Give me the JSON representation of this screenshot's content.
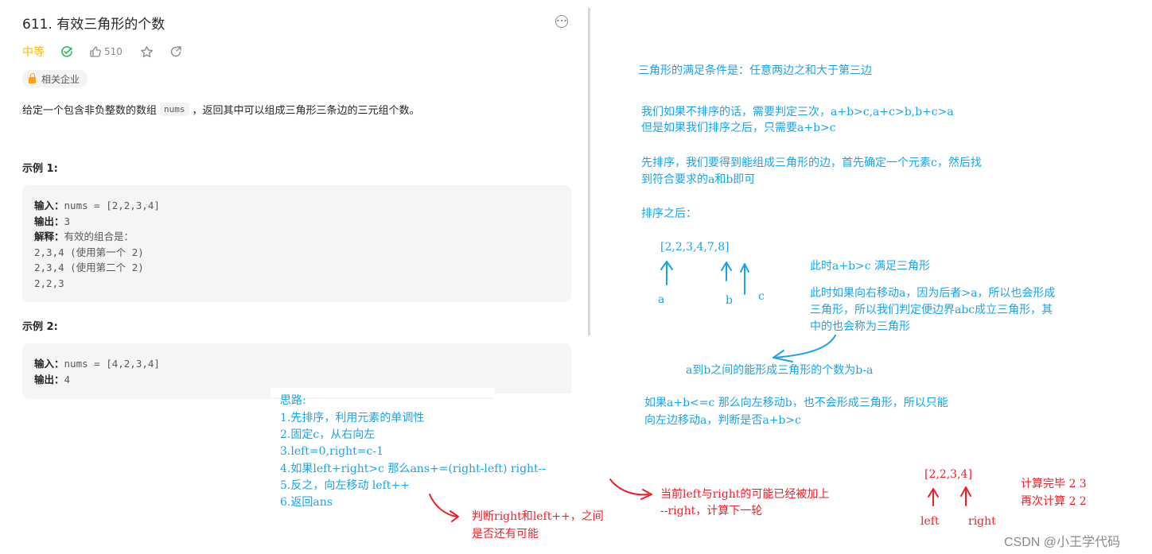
{
  "problem": {
    "title": "611. 有效三角形的个数",
    "difficulty": "中等",
    "likes": "510",
    "tag_label": "相关企业",
    "description_before": "给定一个包含非负整数的数组",
    "description_code": "nums",
    "description_after": "，返回其中可以组成三角形三条边的三元组个数。",
    "icons": {
      "solved": "check-circle-icon",
      "like": "thumbs-up-icon",
      "favorite": "star-icon",
      "share": "share-icon",
      "more": "more-options-icon",
      "tag": "lock-icon"
    },
    "colors": {
      "difficulty": "#ffb800",
      "solved": "#2db55d",
      "lock": "#ffa116"
    },
    "examples": [
      {
        "heading": "示例 1:",
        "input_label": "输入：",
        "input_value": "nums = [2,2,3,4]",
        "output_label": "输出：",
        "output_value": "3",
        "explain_label": "解释：",
        "explain_value": "有效的组合是：",
        "explain_lines": [
          "2,3,4 (使用第一个 2)",
          "2,3,4 (使用第二个 2)",
          "2,2,3"
        ]
      },
      {
        "heading": "示例 2:",
        "input_label": "输入：",
        "input_value": "nums = [4,2,3,4]",
        "output_label": "输出：",
        "output_value": "4"
      }
    ]
  },
  "notes": {
    "colors": {
      "blue": "#1aa3e8",
      "red": "#f01e28"
    },
    "condition": "三角形的满足条件是：任意两边之和大于第三边",
    "unsorted_1": "我们如果不排序的话，需要判定三次，a+b>c,a+c>b,b+c>a",
    "unsorted_2": "但是如果我们排序之后，只需要a+b>c",
    "sort_1": "先排序，我们要得到能组成三角形的边，首先确定一个元素c，然后找",
    "sort_2": "到符合要求的a和b即可",
    "after_sort": "排序之后：",
    "array_blue": "[2,2,3,4,7,8]",
    "pointer_a": "a",
    "pointer_b": "b",
    "pointer_c": "c",
    "satisfied": "此时a+b>c 满足三角形",
    "move_1": "此时如果向右移动a，因为后者>a，所以也会形成",
    "move_2": "三角形，所以我们判定便边界abc成立三角形，其",
    "move_3": "中的也会称为三角形",
    "count_rule": "a到b之间的能形成三角形的个数为b-a",
    "else_1": "如果a+b<=c   那么向左移动b，也不会形成三角形，所以只能",
    "else_2": "向左边移动a，判断是否a+b>c",
    "approach": {
      "heading": "思路:",
      "steps": [
        "1.先排序，利用元素的单调性",
        "2.固定c，从右向左",
        "3.left=0,right=c-1",
        "4.如果left+right>c 那么ans+=(right-left) right--",
        "5.反之，向左移动 left++",
        "6.返回ans"
      ]
    },
    "red_note_left_1": "判断right和left++，之间",
    "red_note_left_2": "是否还有可能",
    "red_note_right_1": "当前left与right的可能已经被加上",
    "red_note_right_2": "--right，计算下一轮",
    "array_red": "[2,2,3,4]",
    "pointer_left": "left",
    "pointer_right": "right",
    "calc_done": "计算完毕 2 3",
    "calc_again": "再次计算 2 2"
  },
  "watermark": "CSDN @小王学代码"
}
